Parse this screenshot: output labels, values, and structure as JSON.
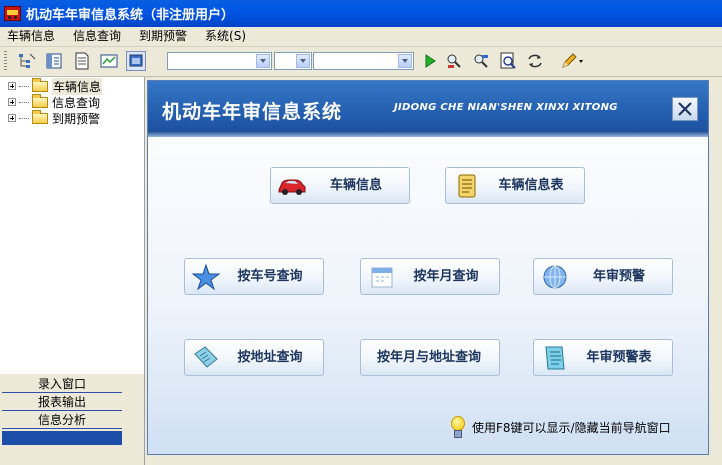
{
  "window": {
    "title": "机动车年审信息系统（非注册用户）"
  },
  "menu": [
    {
      "id": "vehicle",
      "label": "车辆信息"
    },
    {
      "id": "query",
      "label": "信息查询"
    },
    {
      "id": "expire",
      "label": "到期预警"
    },
    {
      "id": "system",
      "label": "系统(S)"
    }
  ],
  "toolbar": {
    "combo1": "",
    "combo2": "",
    "combo3": ""
  },
  "tree": [
    {
      "label": "车辆信息",
      "selected": true
    },
    {
      "label": "信息查询",
      "selected": false
    },
    {
      "label": "到期预警",
      "selected": false
    }
  ],
  "nav": [
    {
      "label": "录入窗口"
    },
    {
      "label": "报表输出"
    },
    {
      "label": "信息分析"
    }
  ],
  "dialog": {
    "title": "机动车年审信息系统",
    "subtitle": "JIDONG CHE NIAN'SHEN XINXI XITONG",
    "buttons": {
      "vehicle_info": "车辆信息",
      "vehicle_table": "车辆信息表",
      "by_plate": "按车号查询",
      "by_month": "按年月查询",
      "warning": "年审预警",
      "by_address": "按地址查询",
      "by_month_address": "按年月与地址查询",
      "warning_table": "年审预警表"
    },
    "hint": "使用F8键可以显示/隐藏当前导航窗口"
  },
  "colors": {
    "titlebar": "#0055e5",
    "banner": "#255fb0",
    "accent": "#1d3660"
  }
}
